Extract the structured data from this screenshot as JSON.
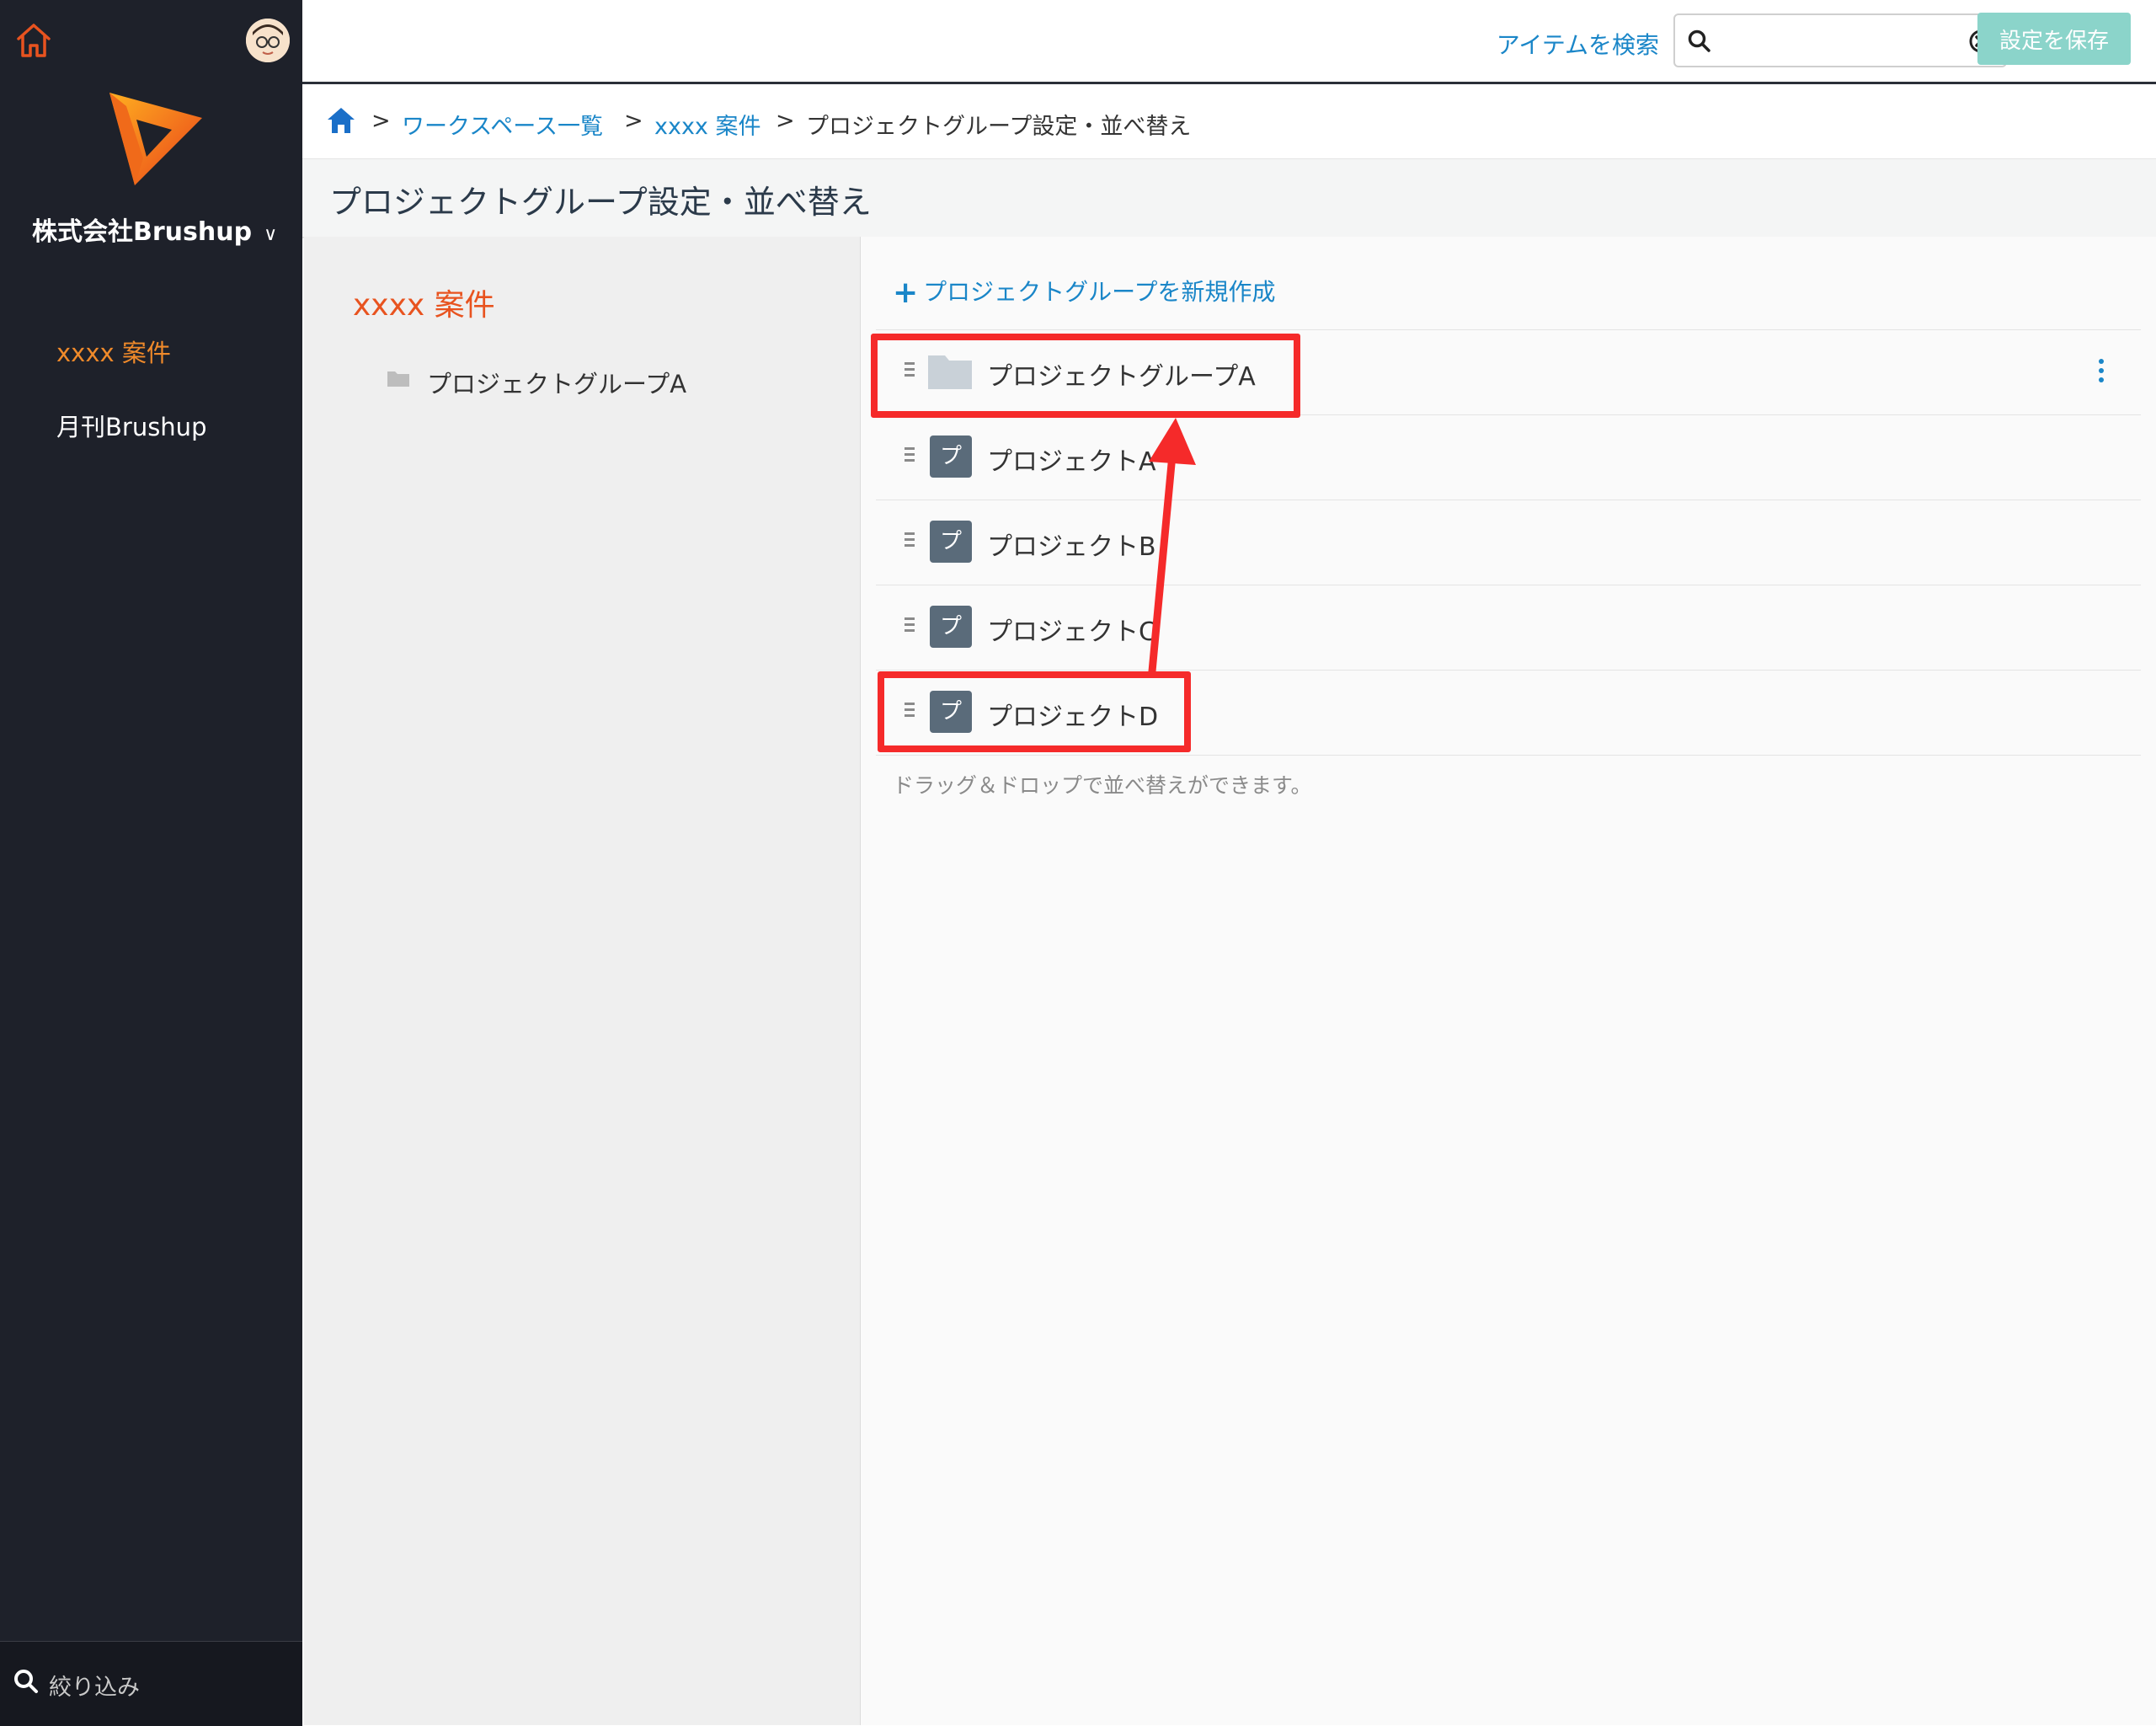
{
  "sidebar": {
    "company_name": "株式会社Brushup",
    "items": [
      {
        "label": "xxxx 案件",
        "active": true
      },
      {
        "label": "月刊Brushup",
        "active": false
      }
    ],
    "filter_placeholder": "絞り込み"
  },
  "topbar": {
    "search_link": "アイテムを検索",
    "search_value": ""
  },
  "breadcrumb": {
    "separator": ">",
    "items": [
      "ワークスペース一覧",
      "xxxx 案件"
    ],
    "current": "プロジェクトグループ設定・並べ替え"
  },
  "titlebar": {
    "title": "プロジェクトグループ設定・並べ替え",
    "save_label": "設定を保存"
  },
  "left_panel": {
    "workspace_title": "xxxx 案件",
    "groups": [
      "プロジェクトグループA"
    ]
  },
  "right_panel": {
    "new_group_label": "プロジェクトグループを新規作成",
    "rows": [
      {
        "type": "group",
        "label": "プロジェクトグループA"
      },
      {
        "type": "project",
        "icon_char": "プ",
        "label": "プロジェクトA"
      },
      {
        "type": "project",
        "icon_char": "プ",
        "label": "プロジェクトB"
      },
      {
        "type": "project",
        "icon_char": "プ",
        "label": "プロジェクトC"
      },
      {
        "type": "project",
        "icon_char": "プ",
        "label": "プロジェクトD"
      }
    ],
    "hint": "ドラッグ＆ドロップで並べ替えができます。"
  },
  "colors": {
    "sidebar_bg": "#1e212a",
    "accent_orange": "#e8531f",
    "link_blue": "#1a86c8",
    "save_button": "#8bd4ca",
    "annotation_red": "#f52a2a"
  }
}
